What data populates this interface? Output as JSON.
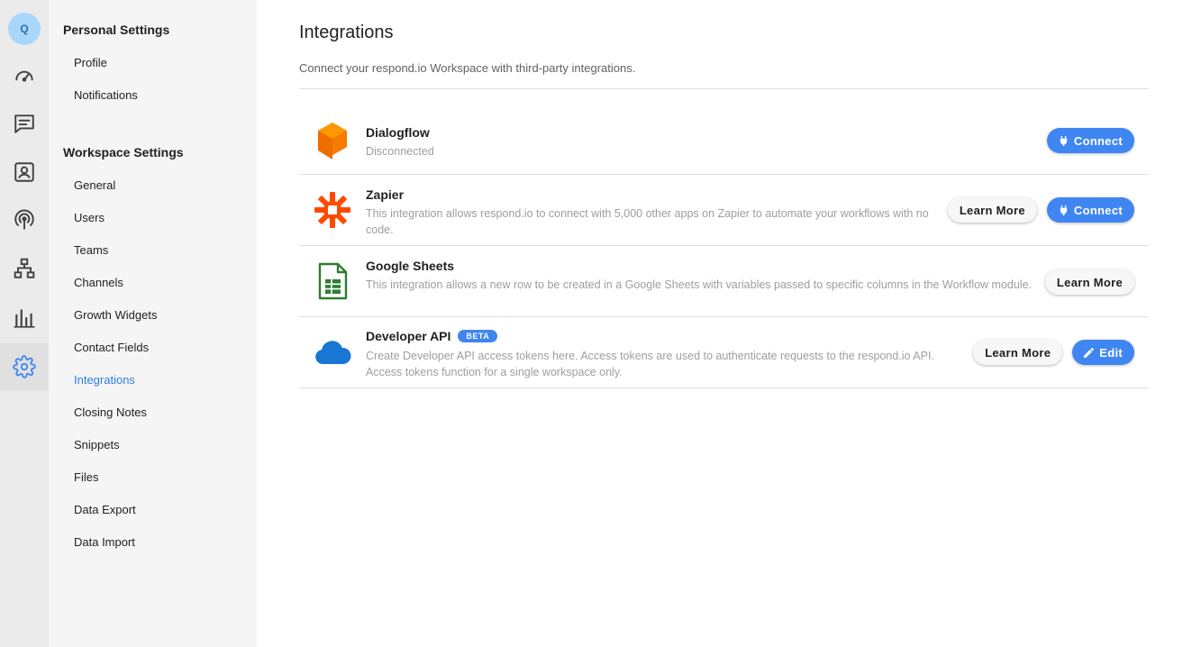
{
  "user": {
    "avatar_initial": "Q"
  },
  "rail": {
    "items": [
      {
        "icon": "dashboard-gauge-icon"
      },
      {
        "icon": "messages-icon"
      },
      {
        "icon": "contacts-icon"
      },
      {
        "icon": "broadcast-icon"
      },
      {
        "icon": "workflows-icon"
      },
      {
        "icon": "reports-icon"
      },
      {
        "icon": "settings-gear-icon",
        "active": true
      }
    ]
  },
  "sidebar": {
    "personal_heading": "Personal Settings",
    "personal_items": [
      "Profile",
      "Notifications"
    ],
    "workspace_heading": "Workspace Settings",
    "workspace_items": [
      "General",
      "Users",
      "Teams",
      "Channels",
      "Growth Widgets",
      "Contact Fields",
      "Integrations",
      "Closing Notes",
      "Snippets",
      "Files",
      "Data Export",
      "Data Import"
    ],
    "active_item": "Integrations"
  },
  "main": {
    "title": "Integrations",
    "subtitle": "Connect your respond.io Workspace with third-party integrations."
  },
  "integrations": [
    {
      "name": "Dialogflow",
      "description": "Disconnected",
      "actions": {
        "connect": "Connect"
      },
      "icon": "dialogflow-logo"
    },
    {
      "name": "Zapier",
      "description": "This integration allows respond.io to connect with 5,000 other apps on Zapier to automate your workflows with no code.",
      "actions": {
        "learn_more": "Learn More",
        "connect": "Connect"
      },
      "icon": "zapier-logo"
    },
    {
      "name": "Google Sheets",
      "description": "This integration allows a new row to be created in a Google Sheets with variables passed to specific columns in the Workflow module.",
      "actions": {
        "learn_more": "Learn More"
      },
      "icon": "google-sheets-logo"
    },
    {
      "name": "Developer API",
      "badge": "BETA",
      "description": "Create Developer API access tokens here. Access tokens are used to authenticate requests to the respond.io API. Access tokens function for a single workspace only.",
      "actions": {
        "learn_more": "Learn More",
        "edit": "Edit"
      },
      "icon": "cloud-api-logo"
    }
  ],
  "colors": {
    "accent": "#3f86f2",
    "active_link": "#2f7de1",
    "dialogflow": "#ef6c00",
    "zapier": "#ff4a00",
    "sheets": "#2e7d32",
    "cloud": "#1976d2"
  }
}
